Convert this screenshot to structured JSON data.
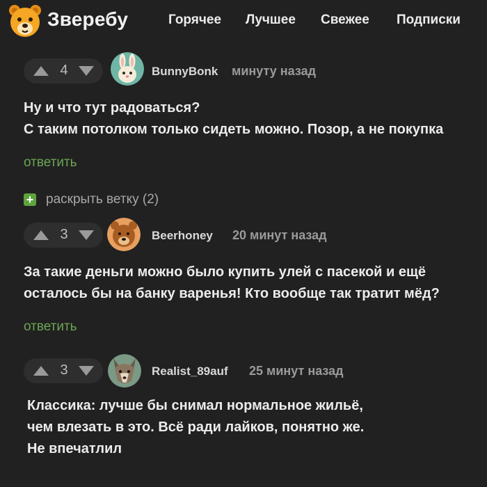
{
  "header": {
    "brand": "Зверебу",
    "logo_icon": "bear-logo-icon",
    "nav": [
      "Горячее",
      "Лучшее",
      "Свежее",
      "Подписки"
    ]
  },
  "comments": [
    {
      "votes": "4",
      "username": "BunnyBonk",
      "time": "минуту назад",
      "avatar_icon": "bunny-avatar-icon",
      "lines": [
        "Ну и что тут радоваться?",
        "С таким потолком только сидеть можно. Позор, а не покупка"
      ],
      "reply": "ответить"
    },
    {
      "votes": "3",
      "username": "Beerhoney",
      "time": "20 минут назад",
      "avatar_icon": "bear-avatar-icon",
      "lines": [
        "За такие деньги можно было купить улей с пасекой и ещё",
        "осталось бы на банку варенья! Кто вообще так тратит мёд?"
      ],
      "reply": "ответить"
    },
    {
      "votes": "3",
      "username": "Realist_89auf",
      "time": "25 минут назад",
      "avatar_icon": "wolf-avatar-icon",
      "lines": [
        "Классика: лучше бы снимал нормальное жильё,",
        "чем влезать в это. Всё ради лайков, понятно же.",
        "Не впечатлил"
      ]
    }
  ],
  "expand": {
    "icon": "plus-icon",
    "label": "раскрыть ветку (2)"
  },
  "colors": {
    "background": "#212121",
    "accent_green": "#6ba553",
    "brand_orange": "#f5a623"
  }
}
